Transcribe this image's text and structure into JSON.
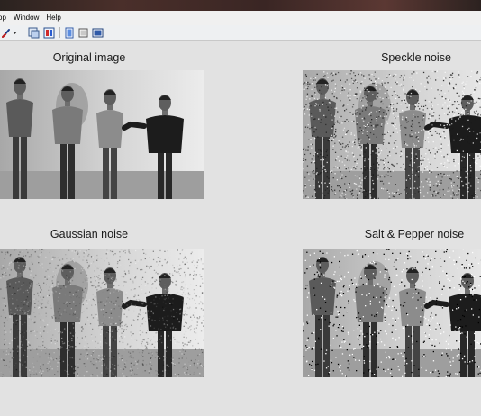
{
  "menu": {
    "items": [
      {
        "id": "desktop",
        "label": "op"
      },
      {
        "id": "window",
        "label": "Window"
      },
      {
        "id": "help",
        "label": "Help"
      }
    ]
  },
  "toolbar": {
    "buttons": [
      {
        "icon": "brush-dropdown-icon"
      },
      {
        "icon": "link-plot-icon"
      },
      {
        "icon": "colorbar-icon"
      },
      {
        "icon": "legend-icon"
      },
      {
        "icon": "hide-plot-tools-icon"
      },
      {
        "icon": "show-plot-tools-icon"
      }
    ]
  },
  "figure": {
    "panels": [
      {
        "id": "original",
        "title": "Original image",
        "noise": "none"
      },
      {
        "id": "speckle",
        "title": "Speckle noise",
        "noise": "speckle"
      },
      {
        "id": "gaussian",
        "title": "Gaussian noise",
        "noise": "gaussian"
      },
      {
        "id": "saltpepper",
        "title": "Salt & Pepper noise",
        "noise": "saltpepper"
      }
    ]
  }
}
